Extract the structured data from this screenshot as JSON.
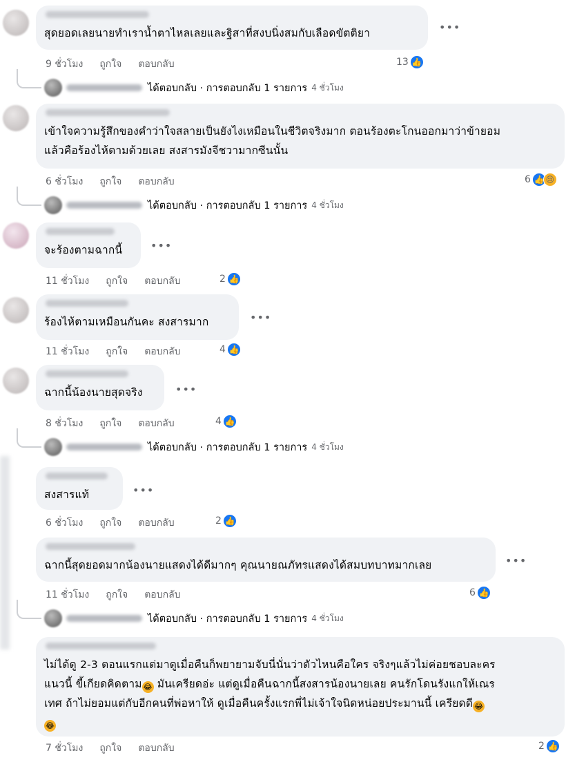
{
  "comments": [
    {
      "text": "สุดยอดเลยนายทำเราน้ำตาไหลเลยและฐิสาที่สงบนิ่งสมกับเลือดขัตติยา",
      "time": "9 ชั่วโมง",
      "like": "ถูกใจ",
      "reply": "ตอบกลับ",
      "reactions": "13",
      "reply_summary": "ได้ตอบกลับ · การตอบกลับ 1 รายการ",
      "reply_time": "4 ชั่วโมง"
    },
    {
      "text": "เข้าใจความรู้สึกของคำว่าใจสลายเป็นยังไงเหมือนในชีวิตจริงมาก ตอนร้องตะโกนออกมาว่าข้ายอม\nแล้วคือร้องไห้ตามด้วยเลย สงสารมังจีชวามากซีนนั้น",
      "time": "6 ชั่วโมง",
      "like": "ถูกใจ",
      "reply": "ตอบกลับ",
      "reactions": "6",
      "reply_summary": "ได้ตอบกลับ · การตอบกลับ 1 รายการ",
      "reply_time": "4 ชั่วโมง"
    },
    {
      "text": "จะร้องตามฉากนี้",
      "time": "11 ชั่วโมง",
      "like": "ถูกใจ",
      "reply": "ตอบกลับ",
      "reactions": "2"
    },
    {
      "text": "ร้องไห้ตามเหมือนกันคะ สงสารมาก",
      "time": "11 ชั่วโมง",
      "like": "ถูกใจ",
      "reply": "ตอบกลับ",
      "reactions": "4"
    },
    {
      "text": "ฉากนี้น้องนายสุดจริง",
      "time": "8 ชั่วโมง",
      "like": "ถูกใจ",
      "reply": "ตอบกลับ",
      "reactions": "4",
      "reply_summary": "ได้ตอบกลับ · การตอบกลับ 1 รายการ",
      "reply_time": "4 ชั่วโมง"
    },
    {
      "text": "สงสารแท้",
      "time": "6 ชั่วโมง",
      "like": "ถูกใจ",
      "reply": "ตอบกลับ",
      "reactions": "2"
    },
    {
      "text": "ฉากนี้สุดยอดมากน้องนายแสดงได้ดีมากๆ คุณนายณภัทรแสดงได้สมบทบาทมากเลย",
      "time": "11 ชั่วโมง",
      "like": "ถูกใจ",
      "reply": "ตอบกลับ",
      "reactions": "6",
      "reply_summary": "ได้ตอบกลับ · การตอบกลับ 1 รายการ",
      "reply_time": "4 ชั่วโมง"
    },
    {
      "line1": "ไม่ได้ดู 2-3 ตอนแรกแต่มาดูเมื่อคืนก็พยายามจับนี่นั่นว่าตัวไหนคือใคร จริงๆแล้วไม่ค่อยชอบละคร",
      "line2a": "แนวนี้ ขี้เกียดคิดตาม",
      "line2b": " มันเครียดอ่ะ แต่ดูเมื่อคืนฉากนี้สงสารน้องนายเลย คนรักโดนรังแกให้เณร",
      "line3a": "เทศ ถ้าไม่ยอมแต่กับอีกคนที่พ่อหาให้ ดูเมื่อคืนครั้งแรกพี่ไม่เจ้าใจนิดหน่อยประมานนี้ เครียดดี",
      "time": "7 ชั่วโมง",
      "like": "ถูกใจ",
      "reply": "ตอบกลับ",
      "reactions": "2"
    }
  ],
  "icons": {
    "more": "more-options-icon",
    "like": "like-reaction-icon",
    "sad": "sad-reaction-icon",
    "laugh": "laughing-emoji-icon"
  },
  "colors": {
    "bubble": "#f0f2f5",
    "like_blue": "#1877f2",
    "meta_gray": "#65676b"
  }
}
